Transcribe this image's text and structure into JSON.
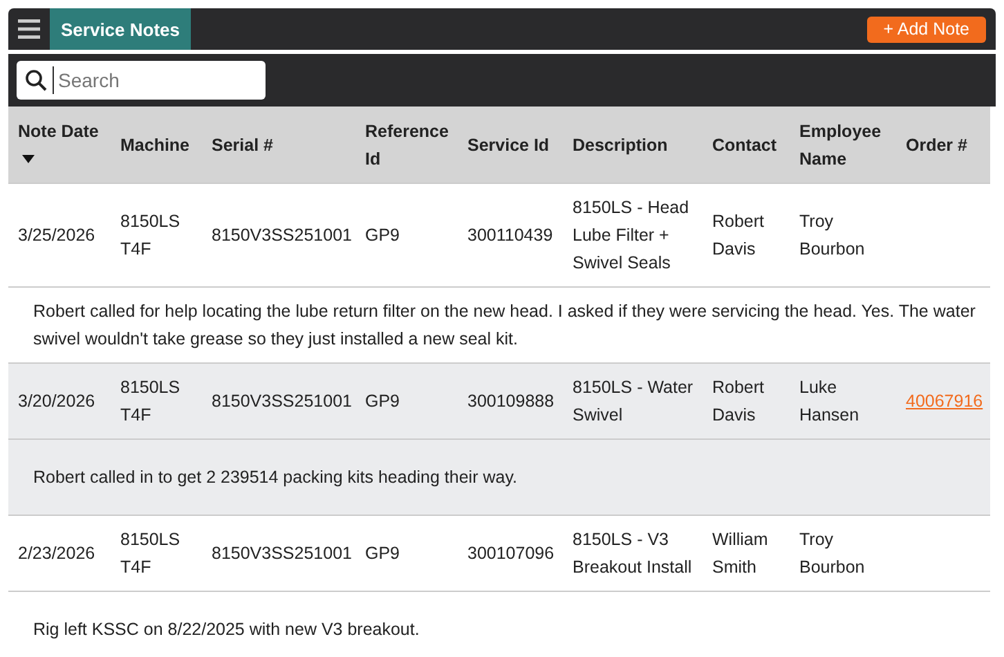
{
  "app_bar": {
    "title": "Service Notes",
    "add_button": "+ Add Note"
  },
  "search": {
    "placeholder": "Search"
  },
  "table": {
    "columns": [
      {
        "label": "Note Date",
        "sorted": true
      },
      {
        "label": "Machine"
      },
      {
        "label": "Serial #"
      },
      {
        "label": "Reference Id"
      },
      {
        "label": "Service Id"
      },
      {
        "label": "Description"
      },
      {
        "label": "Contact"
      },
      {
        "label": "Employee Name"
      },
      {
        "label": "Order #"
      }
    ],
    "rows": [
      {
        "cells": [
          "3/25/2026",
          "8150LS T4F",
          "8150V3SS251001",
          "GP9",
          "300110439",
          "8150LS - Head Lube Filter + Swivel Seals",
          "Robert Davis",
          "Troy Bourbon"
        ],
        "note": "Robert called for help locating the lube return filter on the new head. I asked if they were servicing the head. Yes. The water swivel wouldn't  take grease so they just installed a new seal kit."
      },
      {
        "cells": [
          "3/20/2026",
          "8150LS T4F",
          "8150V3SS251001",
          "GP9",
          "300109888",
          "8150LS - Water Swivel",
          "Robert Davis",
          "Luke Hansen"
        ],
        "order": "40067916",
        "note": "Robert called in to get 2 239514 packing kits heading their way."
      },
      {
        "cells": [
          "2/23/2026",
          "8150LS T4F",
          "8150V3SS251001",
          "GP9",
          "300107096",
          "8150LS - V3 Breakout Install",
          "William Smith",
          "Troy Bourbon"
        ],
        "note": "Rig left KSSC on 8/22/2025 with new V3 breakout."
      }
    ]
  }
}
